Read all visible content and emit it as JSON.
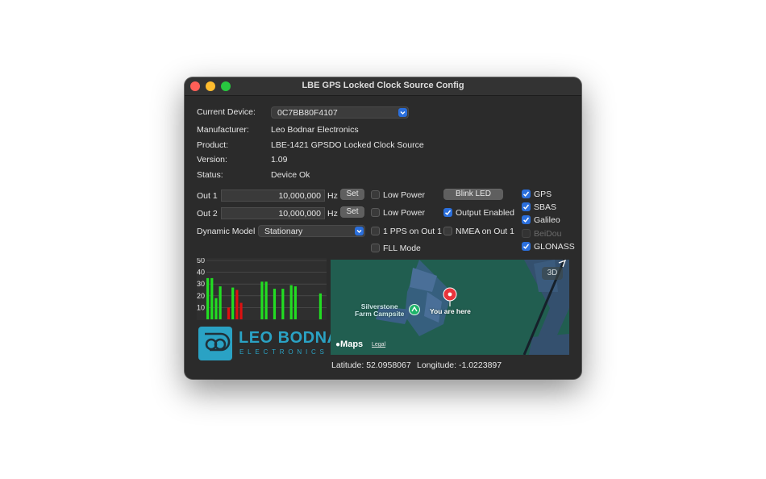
{
  "window": {
    "title": "LBE GPS Locked Clock Source Config"
  },
  "device": {
    "current_label": "Current Device:",
    "current_value": "0C7BB80F4107",
    "manufacturer_label": "Manufacturer:",
    "manufacturer_value": "Leo Bodnar Electronics",
    "product_label": "Product:",
    "product_value": "LBE-1421 GPSDO Locked Clock Source",
    "version_label": "Version:",
    "version_value": "1.09",
    "status_label": "Status:",
    "status_value": "Device Ok"
  },
  "outputs": [
    {
      "label": "Out 1",
      "value": "10,000,000",
      "unit": "Hz",
      "set_label": "Set",
      "low_power_label": "Low Power",
      "low_power": false
    },
    {
      "label": "Out 2",
      "value": "10,000,000",
      "unit": "Hz",
      "set_label": "Set",
      "low_power_label": "Low Power",
      "low_power": false
    }
  ],
  "dynamic_model": {
    "label": "Dynamic Model",
    "value": "Stationary"
  },
  "options": {
    "pps_label": "1 PPS on Out 1",
    "pps": false,
    "fll_label": "FLL Mode",
    "fll": false,
    "blink_label": "Blink LED",
    "output_enabled_label": "Output Enabled",
    "output_enabled": true,
    "nmea_label": "NMEA on Out 1",
    "nmea": false
  },
  "constellations": [
    {
      "name": "GPS",
      "checked": true,
      "enabled": true
    },
    {
      "name": "SBAS",
      "checked": true,
      "enabled": true
    },
    {
      "name": "Galileo",
      "checked": true,
      "enabled": true
    },
    {
      "name": "BeiDou",
      "checked": false,
      "enabled": false
    },
    {
      "name": "GLONASS",
      "checked": true,
      "enabled": true
    }
  ],
  "chart_data": {
    "type": "bar",
    "title": "",
    "xlabel": "",
    "ylabel": "",
    "ylim": [
      0,
      50
    ],
    "yticks": [
      "50",
      "40",
      "30",
      "20",
      "10"
    ],
    "grid": true,
    "series": [
      {
        "color": "#22dd22",
        "values": [
          35,
          35,
          18,
          28,
          0,
          0,
          27,
          0,
          0,
          0,
          0,
          0,
          0,
          32,
          32,
          0,
          26,
          0,
          26,
          0,
          29,
          28,
          0,
          0,
          0,
          0,
          0,
          22
        ]
      },
      {
        "color": "#dd1111",
        "values": [
          0,
          0,
          0,
          0,
          0,
          10,
          0,
          25,
          14,
          0,
          0,
          0,
          0,
          0,
          0,
          0,
          0,
          0,
          0,
          0,
          0,
          0,
          0,
          0,
          0,
          0,
          0,
          0
        ]
      }
    ]
  },
  "logo": {
    "line1": "LEO BODNAR",
    "line2": "ELECTRONICS"
  },
  "map": {
    "place_label_line1": "Silverstone",
    "place_label_line2": "Farm Campsite",
    "pin_label": "You are here",
    "view_3d": "3D",
    "maps_brand": "Maps",
    "legal": "Legal"
  },
  "location": {
    "latitude": "Latitude: 52.0958067",
    "longitude": "Longitude: -1.0223897"
  }
}
